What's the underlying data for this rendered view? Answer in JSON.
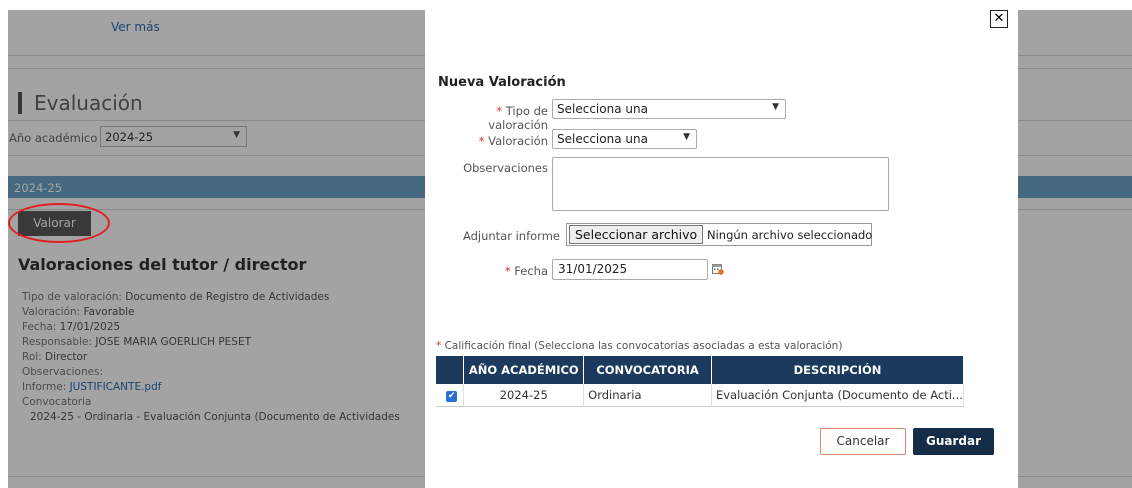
{
  "background": {
    "ver_mas": "Ver más",
    "section_title": "Evaluación",
    "year_label": "Año académico",
    "year_value": "2024-25",
    "year_bar": "2024-25",
    "valorar_button": "Valorar",
    "valoraciones_title": "Valoraciones del tutor / director",
    "details": {
      "tipo_label": "Tipo de valoración:",
      "tipo_value": "Documento de Registro de Actividades",
      "valoracion_label": "Valoración:",
      "valoracion_value": "Favorable",
      "fecha_label": "Fecha:",
      "fecha_value": "17/01/2025",
      "responsable_label": "Responsable:",
      "responsable_value": "JOSE MARIA GOERLICH PESET",
      "rol_label": "Rol:",
      "rol_value": "Director",
      "observaciones_label": "Observaciones:",
      "informe_label": "Informe:",
      "informe_value": "JUSTIFICANTE.pdf",
      "convocatoria_label": "Convocatoria",
      "convocatoria_value": "2024-25 - Ordinaria - Evaluación Conjunta (Documento de Actividades"
    }
  },
  "modal": {
    "title": "Nueva Valoración",
    "tipo_label": "Tipo de valoración",
    "tipo_value": "Selecciona una",
    "valoracion_label": "Valoración",
    "valoracion_value": "Selecciona una",
    "observaciones_label": "Observaciones",
    "adjuntar_label": "Adjuntar informe",
    "file_button": "Seleccionar archivo",
    "file_status": "Ningún archivo seleccionado",
    "fecha_label": "Fecha",
    "fecha_value": "31/01/2025",
    "calificacion_note": "Calificación final (Selecciona las convocatorias asociadas a esta valoración)",
    "table": {
      "headers": [
        "AÑO ACADÉMICO",
        "CONVOCATORIA",
        "DESCRIPCIÓN"
      ],
      "rows": [
        {
          "checked": true,
          "year": "2024-25",
          "convocatoria": "Ordinaria",
          "descripcion": "Evaluación Conjunta (Documento de Acti..."
        }
      ]
    },
    "cancel_button": "Cancelar",
    "save_button": "Guardar",
    "close_symbol": "✕"
  },
  "colors": {
    "required": "#d03030",
    "table_header": "#1b3a5e",
    "save_button": "#142c47",
    "year_bar": "#6ea5c8",
    "highlight_ring": "#e02020"
  },
  "icons": [
    "chevron-down-icon",
    "calendar-icon",
    "checkbox-checked-icon",
    "close-icon"
  ]
}
